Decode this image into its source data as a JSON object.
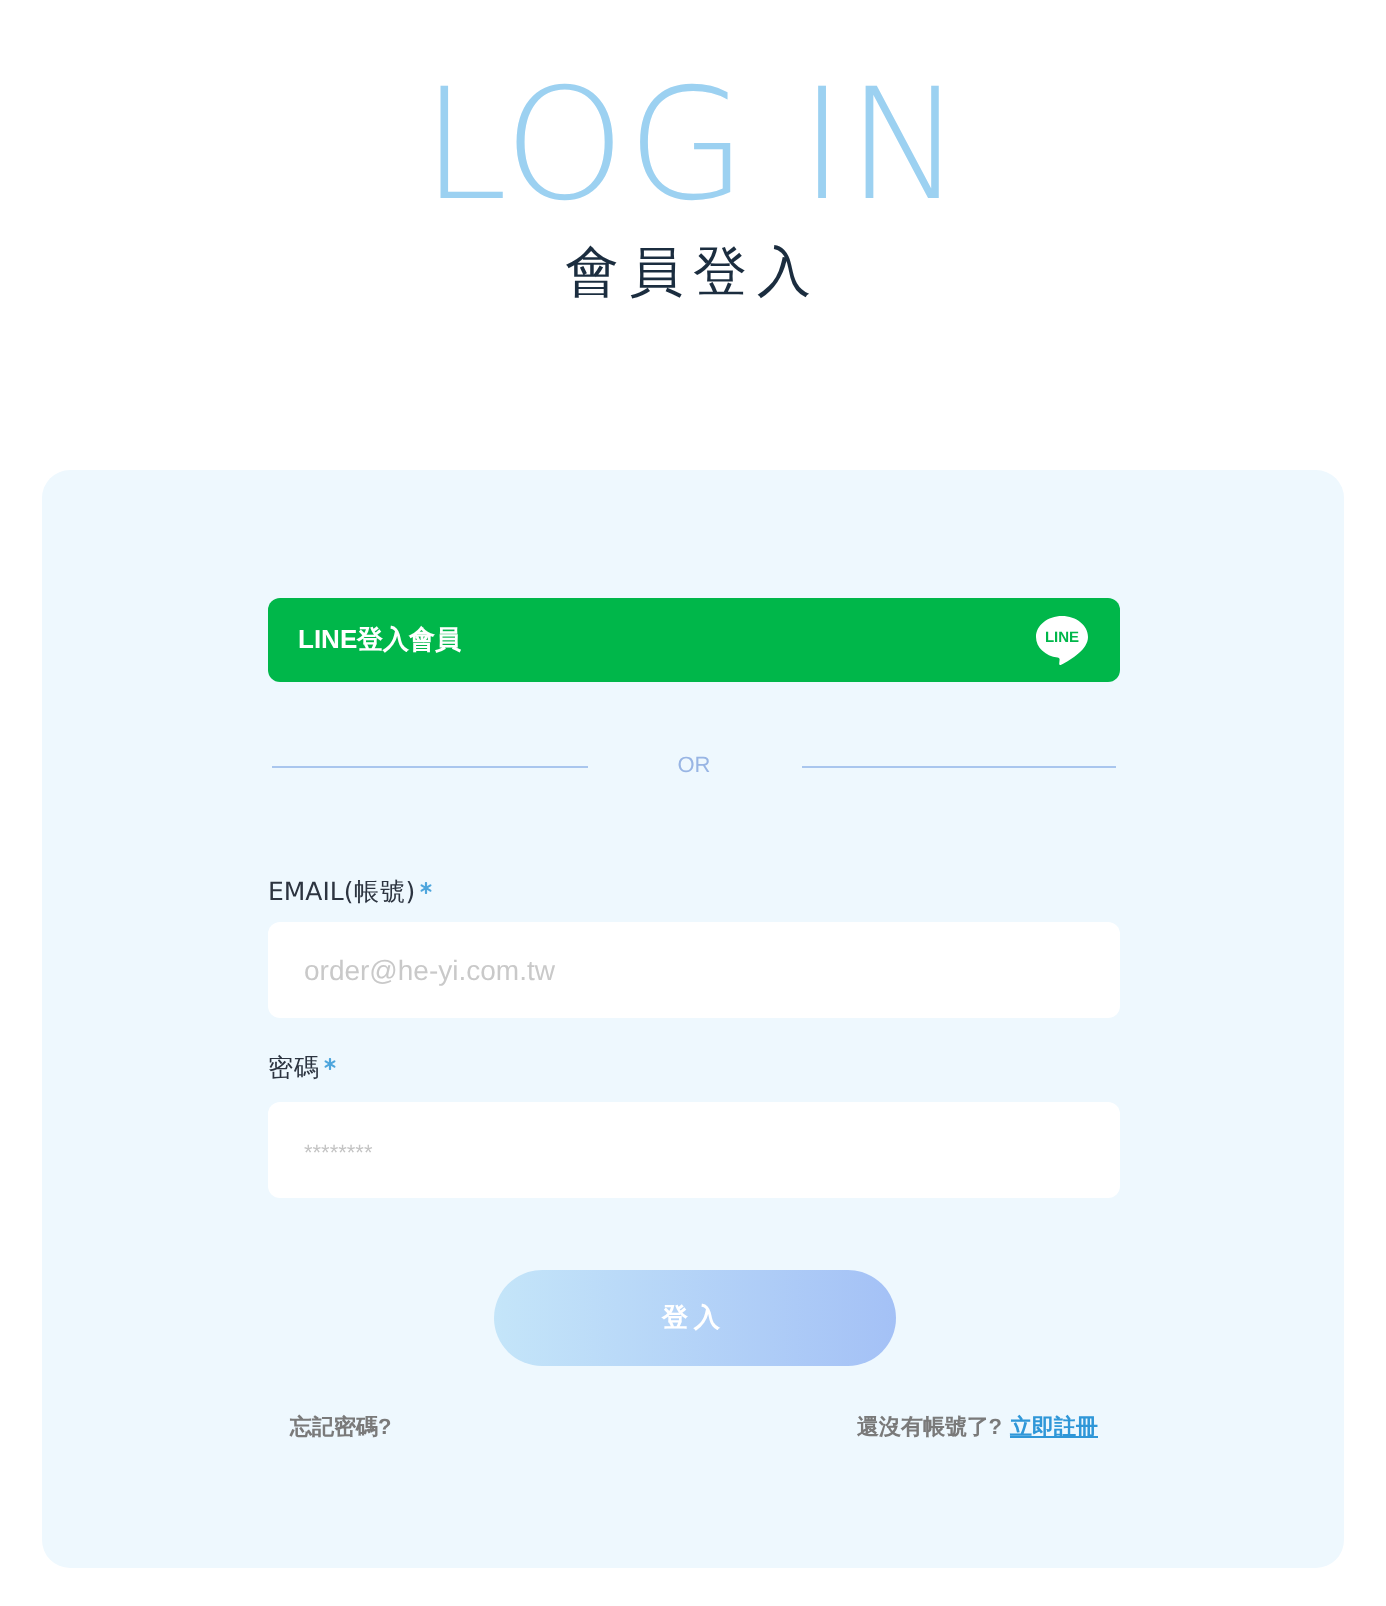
{
  "header": {
    "title": "LOG IN",
    "subtitle": "會員登入"
  },
  "login_card": {
    "line_button": {
      "label": "LINE登入會員",
      "logo_text": "LINE"
    },
    "divider": {
      "label": "OR"
    },
    "fields": [
      {
        "kind": "text",
        "label": "EMAIL(帳號)",
        "required": true,
        "placeholder": "order@he-yi.com.tw"
      },
      {
        "kind": "password",
        "label": "密碼",
        "required": true,
        "placeholder": "********"
      }
    ],
    "submit_button": {
      "label": "登入"
    },
    "forgot_password_link": "忘記密碼?",
    "signup": {
      "prompt": "還沒有帳號了?",
      "link": "立即註冊"
    }
  }
}
